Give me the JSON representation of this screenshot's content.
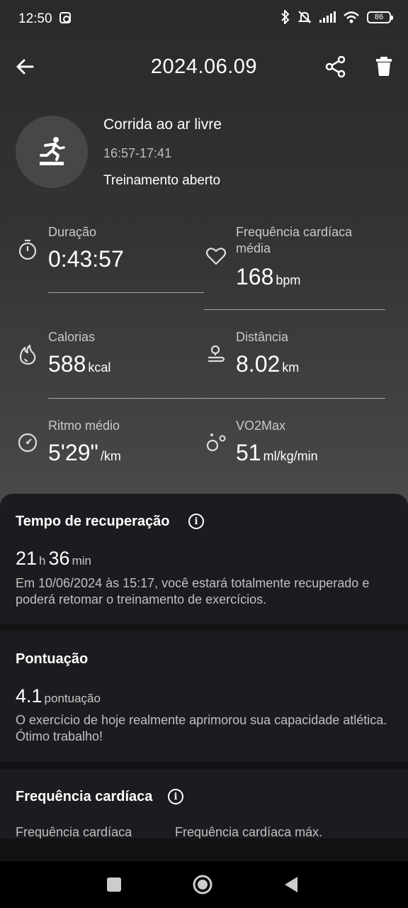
{
  "status_bar": {
    "time": "12:50",
    "battery": "86"
  },
  "header": {
    "title": "2024.06.09"
  },
  "activity": {
    "name": "Corrida ao ar livre",
    "time_range": "16:57-17:41",
    "mode": "Treinamento aberto"
  },
  "metrics": {
    "duration": {
      "label": "Duração",
      "value": "0:43:57"
    },
    "avg_heart_rate": {
      "label_line1": "Frequência cardíaca",
      "label_line2": "média",
      "value": "168",
      "unit": "bpm"
    },
    "calories": {
      "label": "Calorias",
      "value": "588",
      "unit": "kcal"
    },
    "distance": {
      "label": "Distância",
      "value": "8.02",
      "unit": "km"
    },
    "avg_pace": {
      "label": "Ritmo médio",
      "value": "5'29\"",
      "unit": "/km"
    },
    "vo2max": {
      "label": "VO2Max",
      "value": "51",
      "unit": "ml/kg/min"
    }
  },
  "recovery": {
    "title": "Tempo de recuperação",
    "hours": "21",
    "hours_unit": "h",
    "minutes": "36",
    "minutes_unit": "min",
    "description": "Em 10/06/2024 às 15:17, você estará totalmente recuperado e poderá retomar o treinamento de exercícios."
  },
  "score": {
    "title": "Pontuação",
    "value": "4.1",
    "unit": "pontuação",
    "description": "O exercício de hoje realmente aprimorou sua capacidade atlética. Ótimo trabalho!"
  },
  "heart_rate_section": {
    "title": "Frequência cardíaca",
    "col1_label": "Frequência cardíaca",
    "col2_label": "Frequência cardíaca máx."
  }
}
